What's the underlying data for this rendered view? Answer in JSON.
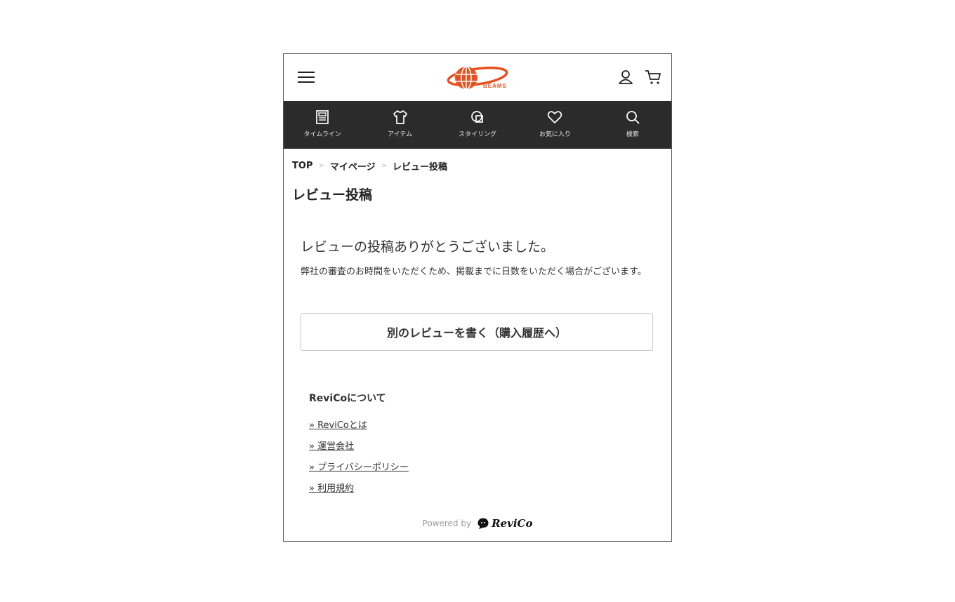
{
  "header": {
    "logo_text": "BEAMS",
    "brand_color": "#e8501e"
  },
  "nav": {
    "items": [
      {
        "label": "タイムライン",
        "icon": "newspaper-icon"
      },
      {
        "label": "アイテム",
        "icon": "tshirt-icon"
      },
      {
        "label": "スタイリング",
        "icon": "styling-icon"
      },
      {
        "label": "お気に入り",
        "icon": "heart-icon"
      },
      {
        "label": "検索",
        "icon": "search-icon"
      }
    ]
  },
  "breadcrumb": {
    "items": [
      "TOP",
      "マイページ",
      "レビュー投稿"
    ],
    "separator": ">"
  },
  "page": {
    "title": "レビュー投稿",
    "thanks_message": "レビューの投稿ありがとうございました。",
    "description": "弊社の審査のお時間をいただくため、掲載までに日数をいただく場合がございます。",
    "action_button_label": "別のレビューを書く（購入履歴へ）"
  },
  "about": {
    "heading": "ReviCoについて",
    "links": [
      "» ReviCoとは",
      "» 運営会社",
      "» プライバシーポリシー",
      "» 利用規約"
    ]
  },
  "footer": {
    "powered_by": "Powered by",
    "brand_name": "ReviCo"
  }
}
